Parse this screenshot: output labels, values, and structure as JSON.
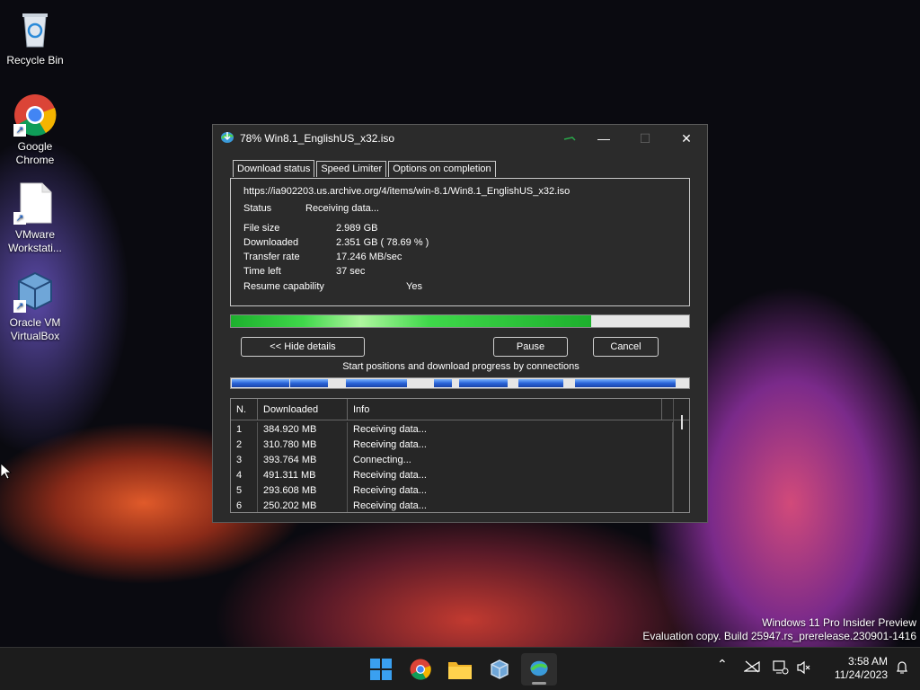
{
  "desktop": {
    "icons": [
      {
        "label": "Recycle Bin",
        "icon": "recycle-bin-icon"
      },
      {
        "label": "Google Chrome",
        "icon": "chrome-icon"
      },
      {
        "label": "VMware Workstati...",
        "icon": "file-icon"
      },
      {
        "label": "Oracle VM VirtualBox",
        "icon": "virtualbox-icon"
      }
    ]
  },
  "window": {
    "title": "78% Win8.1_EnglishUS_x32.iso",
    "tabs": [
      "Download status",
      "Speed Limiter",
      "Options on completion"
    ],
    "url": "https://ia902203.us.archive.org/4/items/win-8.1/Win8.1_EnglishUS_x32.iso",
    "status_label": "Status",
    "status_value": "Receiving data...",
    "fields": [
      {
        "label": "File size",
        "value": "2.989  GB"
      },
      {
        "label": "Downloaded",
        "value": "2.351  GB  ( 78.69 % )"
      },
      {
        "label": "Transfer rate",
        "value": "17.246  MB/sec"
      },
      {
        "label": "Time left",
        "value": "37 sec"
      }
    ],
    "resume_label": "Resume capability",
    "resume_value": "Yes",
    "progress_percent": 78.69,
    "buttons": {
      "hide_details": "<< Hide details",
      "pause": "Pause",
      "cancel": "Cancel"
    },
    "connections_caption": "Start positions and download progress by connections",
    "table": {
      "columns": [
        "N.",
        "Downloaded",
        "Info"
      ],
      "rows": [
        {
          "n": "1",
          "downloaded": "384.920  MB",
          "info": "Receiving data..."
        },
        {
          "n": "2",
          "downloaded": "310.780  MB",
          "info": "Receiving data..."
        },
        {
          "n": "3",
          "downloaded": "393.764  MB",
          "info": "Connecting..."
        },
        {
          "n": "4",
          "downloaded": "491.311  MB",
          "info": "Receiving data..."
        },
        {
          "n": "5",
          "downloaded": "293.608  MB",
          "info": "Receiving data..."
        },
        {
          "n": "6",
          "downloaded": "250.202  MB",
          "info": "Receiving data..."
        }
      ]
    }
  },
  "watermark": {
    "line1": "Windows 11 Pro Insider Preview",
    "line2": "Evaluation copy. Build 25947.rs_prerelease.230901-1416"
  },
  "taskbar": {
    "apps": [
      "start-icon",
      "chrome-icon",
      "file-explorer-icon",
      "virtualbox-icon",
      "idm-icon"
    ],
    "time": "3:58 AM",
    "date": "11/24/2023"
  },
  "colors": {
    "progress_green": "#1db02d",
    "connection_blue": "#2a64d8",
    "window_bg": "#2b2b2b"
  }
}
